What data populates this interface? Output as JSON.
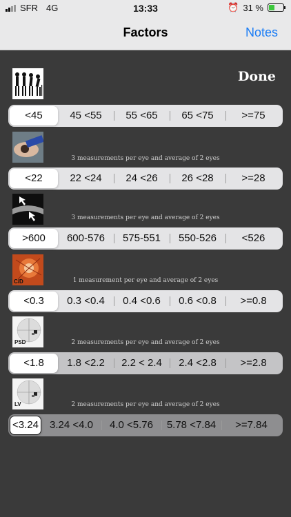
{
  "status_bar": {
    "carrier": "SFR",
    "network": "4G",
    "time": "13:33",
    "battery_percent": "31 %"
  },
  "nav": {
    "title": "Factors",
    "notes_label": "Notes"
  },
  "done_label": "Done",
  "factors": [
    {
      "icon": "aging-people-icon",
      "caption": "",
      "options": [
        "<45",
        "45 <55",
        "55 <65",
        "65 <75",
        ">=75"
      ],
      "selected": 0
    },
    {
      "icon": "tonometry-icon",
      "caption": "3 measurements per eye and average of 2 eyes",
      "options": [
        "<22",
        "22 <24",
        "24 <26",
        "26 <28",
        ">=28"
      ],
      "selected": 0
    },
    {
      "icon": "cornea-thickness-icon",
      "caption": "3 measurements per eye and average of 2 eyes",
      "options": [
        ">600",
        "600-576",
        "575-551",
        "550-526",
        "<526"
      ],
      "selected": 0
    },
    {
      "icon": "optic-disc-icon",
      "icon_label": "C/D",
      "caption": "1 measurement per eye and average of 2 eyes",
      "options": [
        "<0.3",
        "0.3 <0.4",
        "0.4 <0.6",
        "0.6 <0.8",
        ">=0.8"
      ],
      "selected": 0
    },
    {
      "icon": "visual-field-psd-icon",
      "icon_label": "PSD",
      "caption": "2 measurements per eye and average of 2 eyes",
      "options": [
        "<1.8",
        "1.8 <2.2",
        "2.2 < 2.4",
        "2.4 <2.8",
        ">=2.8"
      ],
      "selected": 0
    },
    {
      "icon": "visual-field-lv-icon",
      "icon_label": "LV",
      "caption": "2 measurements per eye and average of 2 eyes",
      "options": [
        "<3.24",
        "3.24 <4.0",
        "4.0 <5.76",
        "5.78 <7.84",
        ">=7.84"
      ],
      "selected": 0
    }
  ],
  "colors": {
    "accent": "#1a7cf5",
    "background": "#3a3a3a",
    "bar": "#e9e9ea"
  }
}
